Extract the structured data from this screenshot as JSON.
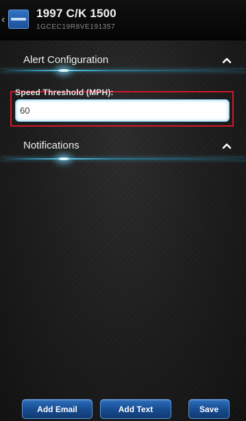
{
  "header": {
    "title": "1997 C/K 1500",
    "subtitle": "1GCEC19R8VE191357",
    "logo_icon": "app-logo-icon",
    "back_icon": "chevron-left-icon"
  },
  "alert_section": {
    "title": "Alert Configuration",
    "expand_icon": "chevron-up-icon"
  },
  "speed_field": {
    "label": "Speed Threshold (MPH):",
    "value": "60"
  },
  "notifications_section": {
    "title": "Notifications",
    "expand_icon": "chevron-up-icon"
  },
  "buttons": {
    "add_email": "Add Email",
    "add_text": "Add Text",
    "save": "Save"
  },
  "colors": {
    "accent_glow": "#5ad0f0",
    "button_blue": "#1c4f97",
    "highlight_red": "#d0182a"
  }
}
